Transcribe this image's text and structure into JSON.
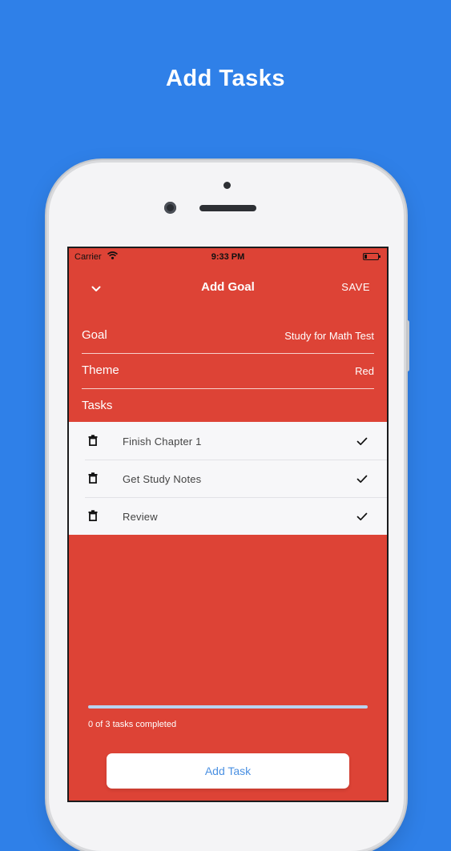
{
  "promo": {
    "title": "Add Tasks"
  },
  "status_bar": {
    "carrier": "Carrier",
    "time": "9:33 PM"
  },
  "nav": {
    "title": "Add Goal",
    "save_label": "SAVE"
  },
  "form": {
    "goal": {
      "label": "Goal",
      "value": "Study for Math Test"
    },
    "theme": {
      "label": "Theme",
      "value": "Red"
    },
    "tasks_label": "Tasks"
  },
  "tasks": [
    {
      "label": "Finish Chapter 1",
      "completed": false
    },
    {
      "label": "Get Study Notes",
      "completed": false
    },
    {
      "label": "Review",
      "completed": false
    }
  ],
  "progress": {
    "text": "0 of 3 tasks completed",
    "fraction": 0.0
  },
  "add_task": {
    "label": "Add Task"
  },
  "colors": {
    "background": "#2f80e8",
    "theme_red": "#dd4336",
    "button_text": "#4a90e2",
    "progress_track": "#b9d3f0"
  },
  "icons": {
    "back": "chevron-down-icon",
    "delete": "trash-icon",
    "complete": "check-icon",
    "wifi": "wifi-icon",
    "battery": "battery-icon"
  }
}
